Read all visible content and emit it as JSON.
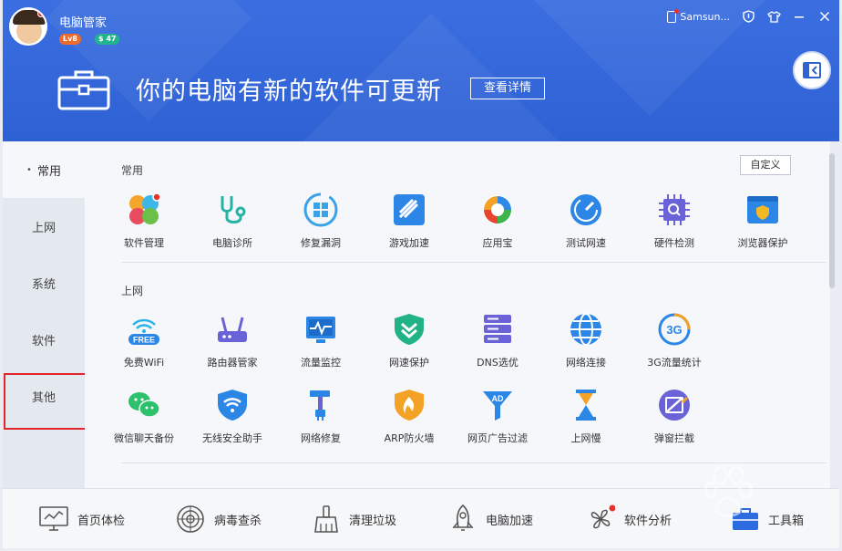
{
  "header": {
    "app_name": "电脑管家",
    "level_badge": "Lv8",
    "money_badge": "$ 47",
    "device_name": "Samsun...",
    "headline": "你的电脑有新的软件可更新",
    "detail_button": "查看详情"
  },
  "sidebar": {
    "items": [
      {
        "label": "常用"
      },
      {
        "label": "上网"
      },
      {
        "label": "系统"
      },
      {
        "label": "软件"
      },
      {
        "label": "其他"
      }
    ]
  },
  "main": {
    "customize_button": "自定义",
    "sections": [
      {
        "title": "常用",
        "tools": [
          {
            "label": "软件管理",
            "icon": "software-manager-icon"
          },
          {
            "label": "电脑诊所",
            "icon": "stethoscope-icon"
          },
          {
            "label": "修复漏洞",
            "icon": "repair-windows-icon"
          },
          {
            "label": "游戏加速",
            "icon": "game-boost-icon"
          },
          {
            "label": "应用宝",
            "icon": "app-store-icon"
          },
          {
            "label": "测试网速",
            "icon": "speedometer-icon"
          },
          {
            "label": "硬件检测",
            "icon": "chip-search-icon"
          },
          {
            "label": "浏览器保护",
            "icon": "browser-shield-icon"
          }
        ]
      },
      {
        "title": "上网",
        "tools": [
          {
            "label": "免费WiFi",
            "icon": "free-wifi-icon"
          },
          {
            "label": "路由器管家",
            "icon": "router-icon"
          },
          {
            "label": "流量监控",
            "icon": "traffic-monitor-icon"
          },
          {
            "label": "网速保护",
            "icon": "speed-shield-icon"
          },
          {
            "label": "DNS选优",
            "icon": "dns-server-icon"
          },
          {
            "label": "网络连接",
            "icon": "globe-icon"
          },
          {
            "label": "3G流量统计",
            "icon": "3g-stats-icon"
          },
          {
            "label": "微信聊天备份",
            "icon": "wechat-icon"
          },
          {
            "label": "无线安全助手",
            "icon": "wifi-shield-icon"
          },
          {
            "label": "网络修复",
            "icon": "hammer-plug-icon"
          },
          {
            "label": "ARP防火墙",
            "icon": "firewall-icon"
          },
          {
            "label": "网页广告过滤",
            "icon": "ad-filter-icon"
          },
          {
            "label": "上网慢",
            "icon": "hourglass-icon"
          },
          {
            "label": "弹窗拦截",
            "icon": "popup-block-icon"
          }
        ]
      }
    ]
  },
  "bottombar": {
    "items": [
      {
        "label": "首页体检",
        "icon": "monitor-chart-icon"
      },
      {
        "label": "病毒查杀",
        "icon": "radar-icon"
      },
      {
        "label": "清理垃圾",
        "icon": "broom-icon"
      },
      {
        "label": "电脑加速",
        "icon": "rocket-icon"
      },
      {
        "label": "软件分析",
        "icon": "fan-icon"
      },
      {
        "label": "工具箱",
        "icon": "toolbox-icon"
      }
    ]
  },
  "colors": {
    "header_blue": "#2f63d3",
    "highlight_red": "#e3262b"
  }
}
